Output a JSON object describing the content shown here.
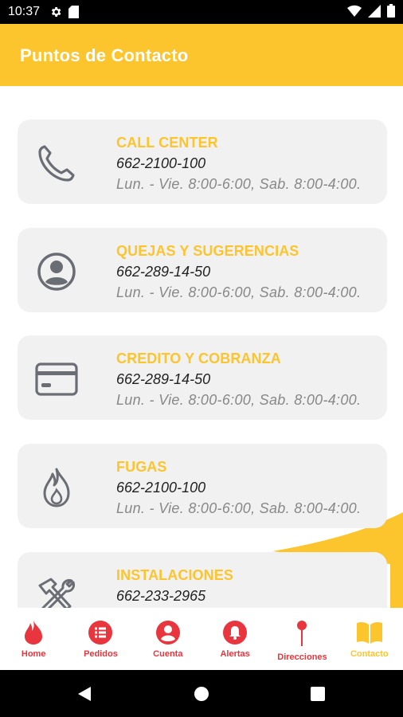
{
  "status_bar": {
    "time": "10:37",
    "icons": [
      "gear-icon",
      "sd-card-icon",
      "wifi-icon",
      "signal-icon",
      "battery-icon"
    ]
  },
  "app_bar": {
    "title": "Puntos de Contacto"
  },
  "colors": {
    "accent": "#fcc42d",
    "nav_red": "#e8353e",
    "card_bg": "#f1f1f1",
    "icon_gray": "#6b6d75"
  },
  "contacts": [
    {
      "icon": "phone-icon",
      "title": "CALL CENTER",
      "phone": "662-2100-100",
      "hours": "Lun. - Vie. 8:00-6:00, Sab. 8:00-4:00."
    },
    {
      "icon": "account-circle-icon",
      "title": "QUEJAS Y SUGERENCIAS",
      "phone": "662-289-14-50",
      "hours": "Lun. - Vie. 8:00-6:00, Sab. 8:00-4:00."
    },
    {
      "icon": "credit-card-icon",
      "title": "CREDITO Y COBRANZA",
      "phone": "662-289-14-50",
      "hours": "Lun. - Vie. 8:00-6:00, Sab. 8:00-4:00."
    },
    {
      "icon": "flame-icon",
      "title": "FUGAS",
      "phone": "662-2100-100",
      "hours": "Lun. - Vie. 8:00-6:00, Sab. 8:00-4:00."
    },
    {
      "icon": "tools-icon",
      "title": "INSTALACIONES",
      "phone": "662-233-2965",
      "hours": ""
    }
  ],
  "bottom_nav": [
    {
      "icon": "fire-icon",
      "label": "Home",
      "active": false
    },
    {
      "icon": "list-icon",
      "label": "Pedidos",
      "active": false
    },
    {
      "icon": "account-icon",
      "label": "Cuenta",
      "active": false
    },
    {
      "icon": "bell-icon",
      "label": "Alertas",
      "active": false
    },
    {
      "icon": "pin-icon",
      "label": "Direcciones",
      "active": false
    },
    {
      "icon": "book-icon",
      "label": "Contacto",
      "active": true
    }
  ],
  "android_nav": [
    "back-icon",
    "home-icon",
    "recents-icon"
  ]
}
